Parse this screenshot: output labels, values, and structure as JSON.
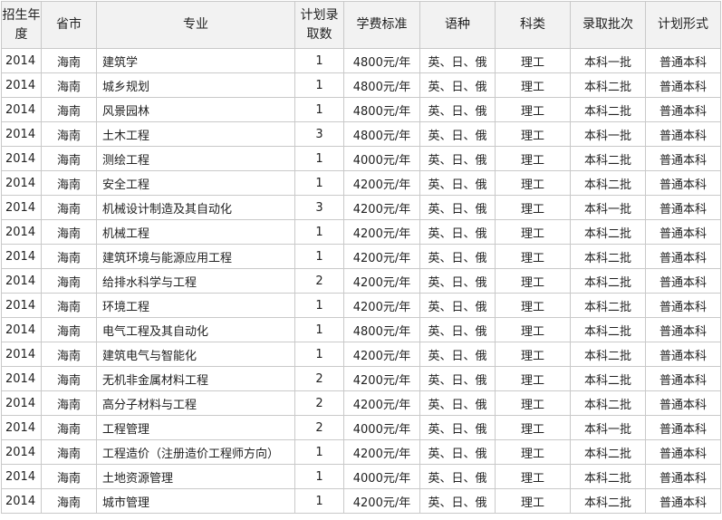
{
  "headers": [
    "招生年度",
    "省市",
    "专业",
    "计划录取数",
    "学费标准",
    "语种",
    "科类",
    "录取批次",
    "计划形式"
  ],
  "rows": [
    [
      "2014",
      "海南",
      "建筑学",
      "1",
      "4800元/年",
      "英、日、俄",
      "理工",
      "本科一批",
      "普通本科"
    ],
    [
      "2014",
      "海南",
      "城乡规划",
      "1",
      "4800元/年",
      "英、日、俄",
      "理工",
      "本科二批",
      "普通本科"
    ],
    [
      "2014",
      "海南",
      "风景园林",
      "1",
      "4800元/年",
      "英、日、俄",
      "理工",
      "本科二批",
      "普通本科"
    ],
    [
      "2014",
      "海南",
      "土木工程",
      "3",
      "4800元/年",
      "英、日、俄",
      "理工",
      "本科一批",
      "普通本科"
    ],
    [
      "2014",
      "海南",
      "测绘工程",
      "1",
      "4000元/年",
      "英、日、俄",
      "理工",
      "本科二批",
      "普通本科"
    ],
    [
      "2014",
      "海南",
      "安全工程",
      "1",
      "4200元/年",
      "英、日、俄",
      "理工",
      "本科二批",
      "普通本科"
    ],
    [
      "2014",
      "海南",
      "机械设计制造及其自动化",
      "3",
      "4200元/年",
      "英、日、俄",
      "理工",
      "本科一批",
      "普通本科"
    ],
    [
      "2014",
      "海南",
      "机械工程",
      "1",
      "4200元/年",
      "英、日、俄",
      "理工",
      "本科二批",
      "普通本科"
    ],
    [
      "2014",
      "海南",
      "建筑环境与能源应用工程",
      "1",
      "4200元/年",
      "英、日、俄",
      "理工",
      "本科二批",
      "普通本科"
    ],
    [
      "2014",
      "海南",
      "给排水科学与工程",
      "2",
      "4200元/年",
      "英、日、俄",
      "理工",
      "本科二批",
      "普通本科"
    ],
    [
      "2014",
      "海南",
      "环境工程",
      "1",
      "4200元/年",
      "英、日、俄",
      "理工",
      "本科二批",
      "普通本科"
    ],
    [
      "2014",
      "海南",
      "电气工程及其自动化",
      "1",
      "4800元/年",
      "英、日、俄",
      "理工",
      "本科二批",
      "普通本科"
    ],
    [
      "2014",
      "海南",
      "建筑电气与智能化",
      "1",
      "4200元/年",
      "英、日、俄",
      "理工",
      "本科二批",
      "普通本科"
    ],
    [
      "2014",
      "海南",
      "无机非金属材料工程",
      "2",
      "4200元/年",
      "英、日、俄",
      "理工",
      "本科二批",
      "普通本科"
    ],
    [
      "2014",
      "海南",
      "高分子材料与工程",
      "2",
      "4200元/年",
      "英、日、俄",
      "理工",
      "本科二批",
      "普通本科"
    ],
    [
      "2014",
      "海南",
      "工程管理",
      "2",
      "4000元/年",
      "英、日、俄",
      "理工",
      "本科一批",
      "普通本科"
    ],
    [
      "2014",
      "海南",
      "工程造价（注册造价工程师方向）",
      "1",
      "4200元/年",
      "英、日、俄",
      "理工",
      "本科二批",
      "普通本科"
    ],
    [
      "2014",
      "海南",
      "土地资源管理",
      "1",
      "4000元/年",
      "英、日、俄",
      "理工",
      "本科二批",
      "普通本科"
    ],
    [
      "2014",
      "海南",
      "城市管理",
      "1",
      "4200元/年",
      "英、日、俄",
      "理工",
      "本科二批",
      "普通本科"
    ]
  ]
}
